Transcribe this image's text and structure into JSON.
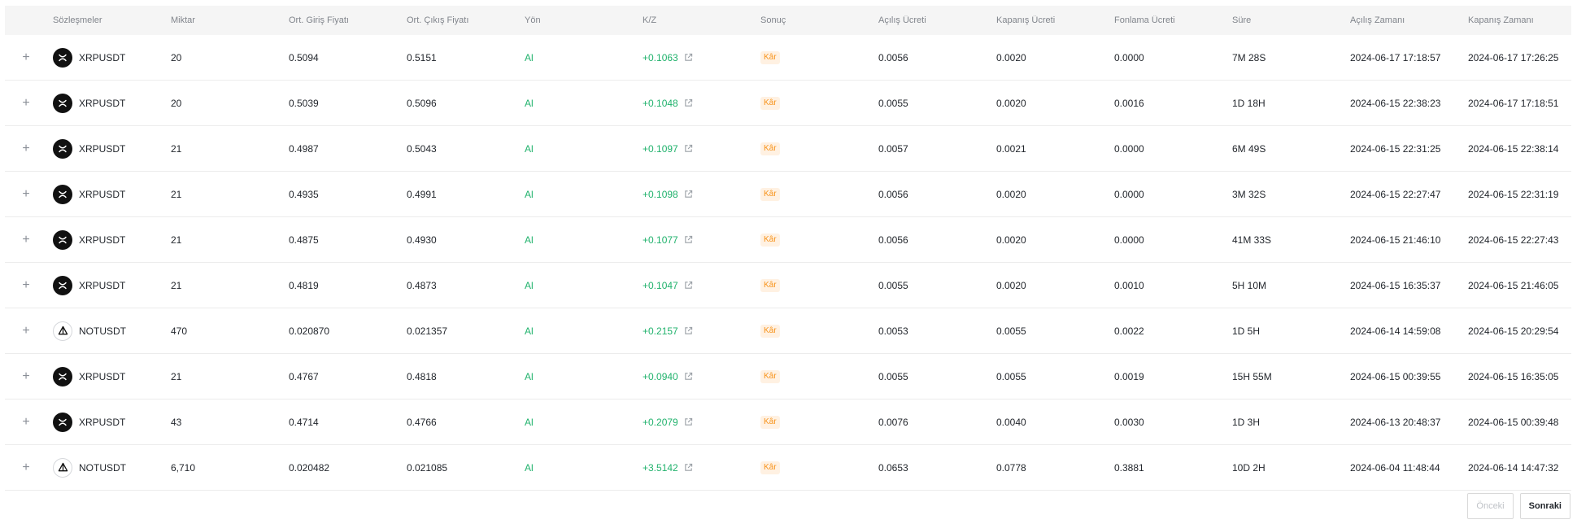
{
  "columns": [
    "Sözleşmeler",
    "Miktar",
    "Ort. Giriş Fiyatı",
    "Ort. Çıkış Fiyatı",
    "Yön",
    "K/Z",
    "Sonuç",
    "Açılış Ücreti",
    "Kapanış Ücreti",
    "Fonlama Ücreti",
    "Süre",
    "Açılış Zamanı",
    "Kapanış Zamanı"
  ],
  "rows": [
    {
      "symbol": "XRPUSDT",
      "coin": "xrp",
      "qty": "20",
      "entry": "0.5094",
      "exit": "0.5151",
      "side": "Al",
      "pnl": "+0.1063",
      "result": "Kâr",
      "open_fee": "0.0056",
      "close_fee": "0.0020",
      "funding_fee": "0.0000",
      "duration": "7M 28S",
      "open_time": "2024-06-17 17:18:57",
      "close_time": "2024-06-17 17:26:25"
    },
    {
      "symbol": "XRPUSDT",
      "coin": "xrp",
      "qty": "20",
      "entry": "0.5039",
      "exit": "0.5096",
      "side": "Al",
      "pnl": "+0.1048",
      "result": "Kâr",
      "open_fee": "0.0055",
      "close_fee": "0.0020",
      "funding_fee": "0.0016",
      "duration": "1D 18H",
      "open_time": "2024-06-15 22:38:23",
      "close_time": "2024-06-17 17:18:51"
    },
    {
      "symbol": "XRPUSDT",
      "coin": "xrp",
      "qty": "21",
      "entry": "0.4987",
      "exit": "0.5043",
      "side": "Al",
      "pnl": "+0.1097",
      "result": "Kâr",
      "open_fee": "0.0057",
      "close_fee": "0.0021",
      "funding_fee": "0.0000",
      "duration": "6M 49S",
      "open_time": "2024-06-15 22:31:25",
      "close_time": "2024-06-15 22:38:14"
    },
    {
      "symbol": "XRPUSDT",
      "coin": "xrp",
      "qty": "21",
      "entry": "0.4935",
      "exit": "0.4991",
      "side": "Al",
      "pnl": "+0.1098",
      "result": "Kâr",
      "open_fee": "0.0056",
      "close_fee": "0.0020",
      "funding_fee": "0.0000",
      "duration": "3M 32S",
      "open_time": "2024-06-15 22:27:47",
      "close_time": "2024-06-15 22:31:19"
    },
    {
      "symbol": "XRPUSDT",
      "coin": "xrp",
      "qty": "21",
      "entry": "0.4875",
      "exit": "0.4930",
      "side": "Al",
      "pnl": "+0.1077",
      "result": "Kâr",
      "open_fee": "0.0056",
      "close_fee": "0.0020",
      "funding_fee": "0.0000",
      "duration": "41M 33S",
      "open_time": "2024-06-15 21:46:10",
      "close_time": "2024-06-15 22:27:43"
    },
    {
      "symbol": "XRPUSDT",
      "coin": "xrp",
      "qty": "21",
      "entry": "0.4819",
      "exit": "0.4873",
      "side": "Al",
      "pnl": "+0.1047",
      "result": "Kâr",
      "open_fee": "0.0055",
      "close_fee": "0.0020",
      "funding_fee": "0.0010",
      "duration": "5H 10M",
      "open_time": "2024-06-15 16:35:37",
      "close_time": "2024-06-15 21:46:05"
    },
    {
      "symbol": "NOTUSDT",
      "coin": "not",
      "qty": "470",
      "entry": "0.020870",
      "exit": "0.021357",
      "side": "Al",
      "pnl": "+0.2157",
      "result": "Kâr",
      "open_fee": "0.0053",
      "close_fee": "0.0055",
      "funding_fee": "0.0022",
      "duration": "1D 5H",
      "open_time": "2024-06-14 14:59:08",
      "close_time": "2024-06-15 20:29:54"
    },
    {
      "symbol": "XRPUSDT",
      "coin": "xrp",
      "qty": "21",
      "entry": "0.4767",
      "exit": "0.4818",
      "side": "Al",
      "pnl": "+0.0940",
      "result": "Kâr",
      "open_fee": "0.0055",
      "close_fee": "0.0055",
      "funding_fee": "0.0019",
      "duration": "15H 55M",
      "open_time": "2024-06-15 00:39:55",
      "close_time": "2024-06-15 16:35:05"
    },
    {
      "symbol": "XRPUSDT",
      "coin": "xrp",
      "qty": "43",
      "entry": "0.4714",
      "exit": "0.4766",
      "side": "Al",
      "pnl": "+0.2079",
      "result": "Kâr",
      "open_fee": "0.0076",
      "close_fee": "0.0040",
      "funding_fee": "0.0030",
      "duration": "1D 3H",
      "open_time": "2024-06-13 20:48:37",
      "close_time": "2024-06-15 00:39:48"
    },
    {
      "symbol": "NOTUSDT",
      "coin": "not",
      "qty": "6,710",
      "entry": "0.020482",
      "exit": "0.021085",
      "side": "Al",
      "pnl": "+3.5142",
      "result": "Kâr",
      "open_fee": "0.0653",
      "close_fee": "0.0778",
      "funding_fee": "0.3881",
      "duration": "10D 2H",
      "open_time": "2024-06-04 11:48:44",
      "close_time": "2024-06-14 14:47:32"
    }
  ],
  "pagination": {
    "prev_label": "Önceki",
    "next_label": "Sonraki"
  },
  "colors": {
    "profit": "#20b26c",
    "badge_text": "#f7931a",
    "badge_bg": "#fff1e2",
    "header_bg": "#f5f5f5"
  },
  "icons": {
    "expand": "plus-icon",
    "xrp": "xrp-logo-icon",
    "not": "notcoin-logo-icon",
    "external": "external-link-icon"
  }
}
